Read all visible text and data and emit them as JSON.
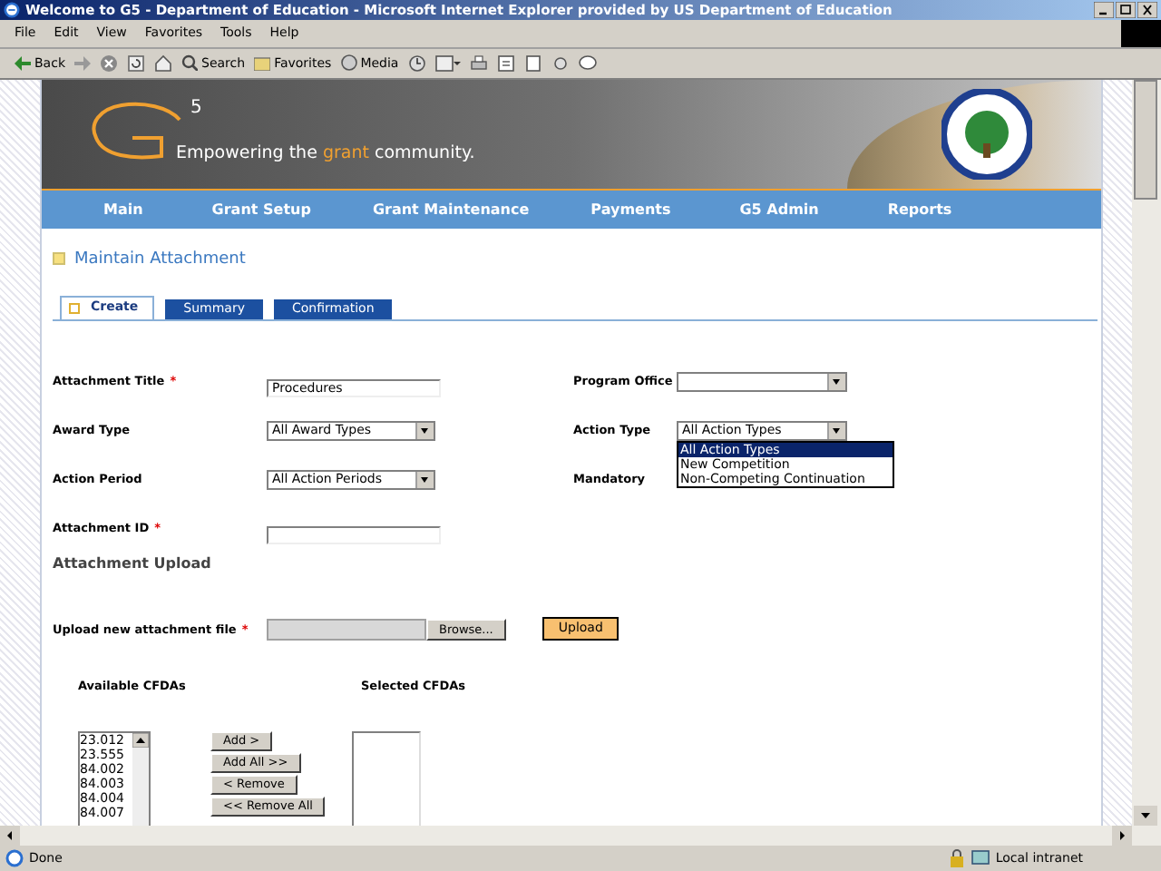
{
  "window": {
    "title": "Welcome to G5 - Department of Education - Microsoft Internet Explorer provided by US Department of Education"
  },
  "menu": [
    "File",
    "Edit",
    "View",
    "Favorites",
    "Tools",
    "Help"
  ],
  "toolbar": [
    {
      "kind": "back",
      "label": "Back"
    },
    {
      "kind": "search",
      "label": "Search"
    },
    {
      "kind": "favorites",
      "label": "Favorites"
    },
    {
      "kind": "media",
      "label": "Media"
    }
  ],
  "banner": {
    "logo_superscript": "5",
    "tagline_before": "Empowering the ",
    "tagline_highlight": "grant",
    "tagline_after": " community."
  },
  "nav": [
    "Main",
    "Grant Setup",
    "Grant Maintenance",
    "Payments",
    "G5 Admin",
    "Reports"
  ],
  "heading": "Maintain Attachment",
  "tabs": [
    {
      "label": "Create",
      "selected": true
    },
    {
      "label": "Summary",
      "selected": false
    },
    {
      "label": "Confirmation",
      "selected": false
    }
  ],
  "form_rows": [
    {
      "left": {
        "label": "Attachment Title",
        "required_mark": "*",
        "kind": "text",
        "value": "Procedures"
      },
      "right": {
        "label": "Program Office",
        "kind": "select"
      }
    },
    {
      "left": {
        "label": "Award Type",
        "kind": "select",
        "value": "All Award Types"
      },
      "right": {
        "label": "Action Type",
        "kind": "select",
        "value": "All Action Types",
        "expanded": true,
        "options": [
          {
            "label": "All Action Types",
            "selected": true
          },
          {
            "label": "New Competition",
            "selected": false
          },
          {
            "label": "Non-Competing Continuation",
            "selected": false
          }
        ]
      }
    },
    {
      "left": {
        "label": "Action Period",
        "kind": "select",
        "value": "All Action Periods"
      },
      "right": {
        "label": "Mandatory",
        "kind": "none"
      }
    },
    {
      "left": {
        "label": "Attachment ID",
        "required_mark": "*",
        "kind": "text"
      }
    }
  ],
  "upload_section": "Attachment Upload",
  "upload": {
    "label": "Upload new attachment file",
    "required_mark": "*",
    "browse": "Browse...",
    "button": "Upload"
  },
  "cfda": {
    "available_label": "Available CFDAs",
    "selected_label": "Selected CFDAs",
    "available": [
      "23.012",
      "23.555",
      "84.002",
      "84.003",
      "84.004",
      "84.007"
    ],
    "buttons": [
      "Add >",
      "Add All >>",
      "< Remove",
      "<< Remove All"
    ]
  },
  "status_bar": {
    "text": "Done",
    "zone": "Local intranet"
  }
}
